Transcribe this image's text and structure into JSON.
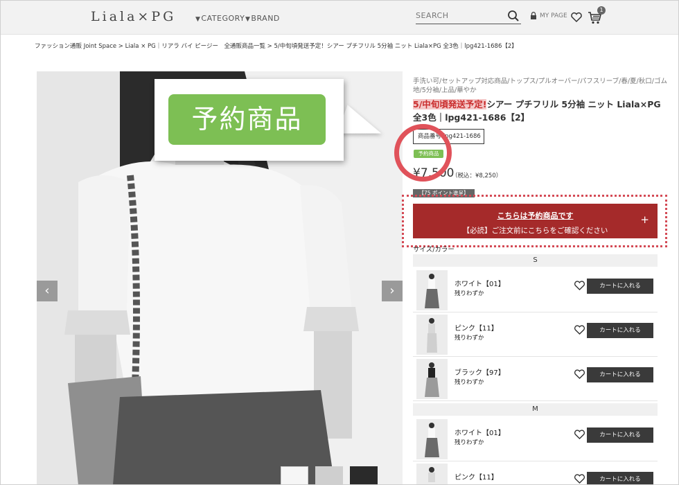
{
  "header": {
    "logo": "Liala×PG",
    "nav": [
      {
        "label": "CATEGORY"
      },
      {
        "label": "BRAND"
      }
    ],
    "search_placeholder": "SEARCH",
    "mypage_label": "MY PAGE",
    "cart_count": "1"
  },
  "breadcrumb": "ファッション通販 Joint Space > Liala × PG｜リアラ バイ ピージー　全通販商品一覧 > 5/中旬頃発送予定！シアー プチフリル 5分袖 ニット Liala×PG 全3色｜lpg421-1686【2】",
  "callout": {
    "label": "予約商品"
  },
  "product": {
    "tags": "手洗い可/セットアップ対応商品/トップス/プルオーバー/パフスリーブ/春/夏/秋口/ゴム地/5分袖/上品/華やか",
    "title_highlight": "5/中旬頃発送予定!",
    "title_rest": "シアー プチフリル 5分袖 ニット Liala×PG 全3色｜lpg421-1686【2】",
    "sku_label": "商品番号 lpg421-1686",
    "preorder_tag": "予約商品",
    "price": "¥7,500",
    "price_tax": "（税込：¥8,250）",
    "point_badge": "【75 ポイント進呈】",
    "notice_line1": "こちらは予約商品です",
    "notice_line2": "【必読】ご注文前にこちらをご確認ください",
    "notice_plus": "+",
    "size_color_label": "サイズ/カラー"
  },
  "sizes": [
    {
      "size": "S",
      "items": [
        {
          "color": "ホワイト【01】",
          "stock": "残りわずか",
          "cart": "カートに入れる"
        },
        {
          "color": "ピンク【11】",
          "stock": "残りわずか",
          "cart": "カートに入れる"
        },
        {
          "color": "ブラック【97】",
          "stock": "残りわずか",
          "cart": "カートに入れる"
        }
      ]
    },
    {
      "size": "M",
      "items": [
        {
          "color": "ホワイト【01】",
          "stock": "残りわずか",
          "cart": "カートに入れる"
        },
        {
          "color": "ピンク【11】",
          "stock": "",
          "cart": "カートに入れる"
        }
      ]
    }
  ],
  "colors": {
    "preorder_green": "#7dbf54",
    "notice_red": "#a52a2a",
    "highlight_pink": "#f4c8c8",
    "annotation_red": "#e0525a"
  }
}
